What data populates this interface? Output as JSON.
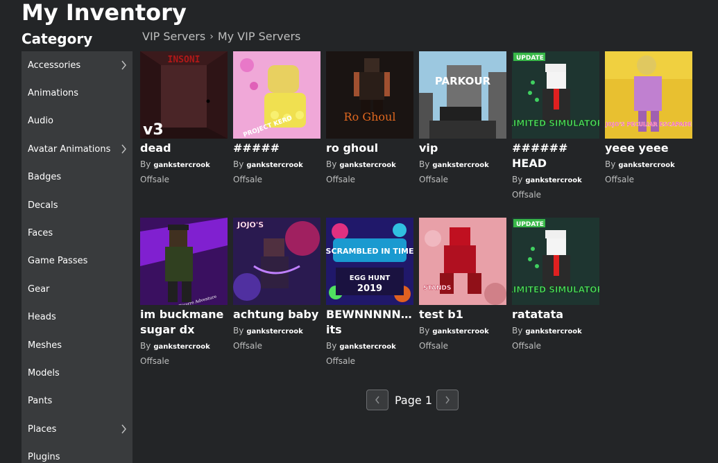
{
  "header": {
    "title": "My Inventory"
  },
  "sidebar": {
    "heading": "Category",
    "items": [
      {
        "label": "Accessories",
        "has_children": true
      },
      {
        "label": "Animations",
        "has_children": false
      },
      {
        "label": "Audio",
        "has_children": false
      },
      {
        "label": "Avatar Animations",
        "has_children": true
      },
      {
        "label": "Badges",
        "has_children": false
      },
      {
        "label": "Decals",
        "has_children": false
      },
      {
        "label": "Faces",
        "has_children": false
      },
      {
        "label": "Game Passes",
        "has_children": false
      },
      {
        "label": "Gear",
        "has_children": false
      },
      {
        "label": "Heads",
        "has_children": false
      },
      {
        "label": "Meshes",
        "has_children": false
      },
      {
        "label": "Models",
        "has_children": false
      },
      {
        "label": "Pants",
        "has_children": false
      },
      {
        "label": "Places",
        "has_children": true
      },
      {
        "label": "Plugins",
        "has_children": false
      }
    ]
  },
  "breadcrumb": {
    "parent": "VIP Servers",
    "current": "My VIP Servers"
  },
  "items": [
    {
      "name": "dead",
      "by": "By",
      "creator": "gankstercrook",
      "price": "Offsale",
      "thumb_text": "INSONI",
      "thumb_sub": "v3"
    },
    {
      "name": "#####",
      "by": "By",
      "creator": "gankstercrook",
      "price": "Offsale",
      "thumb_text": "PROJECT KERO",
      "thumb_sub": ""
    },
    {
      "name": "ro ghoul",
      "by": "By",
      "creator": "gankstercrook",
      "price": "Offsale",
      "thumb_text": "Ro Ghoul",
      "thumb_sub": ""
    },
    {
      "name": "vip",
      "by": "By",
      "creator": "gankstercrook",
      "price": "Offsale",
      "thumb_text": "PARKOUR",
      "thumb_sub": ""
    },
    {
      "name": "###### HEAD",
      "by": "By",
      "creator": "gankstercrook",
      "price": "Offsale",
      "thumb_text": "LIMITED SIMULATOR",
      "thumb_sub": "UPDATE"
    },
    {
      "name": "yeee yeee",
      "by": "By",
      "creator": "gankstercrook",
      "price": "Offsale",
      "thumb_text": "JOJO'S PECULIAR ESCAPADE",
      "thumb_sub": ""
    },
    {
      "name": "im buckmane sugar dx",
      "by": "By",
      "creator": "gankstercrook",
      "price": "Offsale",
      "thumb_text": "Bizarre Adventure",
      "thumb_sub": ""
    },
    {
      "name": "achtung baby",
      "by": "By",
      "creator": "gankstercrook",
      "price": "Offsale",
      "thumb_text": "JOJO'S",
      "thumb_sub": ""
    },
    {
      "name": "BEWNNNNNNNNNNNNN its",
      "by": "By",
      "creator": "gankstercrook",
      "price": "Offsale",
      "thumb_text": "SCRAMBLED IN TIME",
      "thumb_sub": "EGG HUNT 2019"
    },
    {
      "name": "test b1",
      "by": "By",
      "creator": "gankstercrook",
      "price": "Offsale",
      "thumb_text": "STANDS",
      "thumb_sub": ""
    },
    {
      "name": "ratatata",
      "by": "By",
      "creator": "gankstercrook",
      "price": "Offsale",
      "thumb_text": "LIMITED SIMULATOR",
      "thumb_sub": "UPDATE"
    }
  ],
  "pager": {
    "label": "Page 1"
  }
}
